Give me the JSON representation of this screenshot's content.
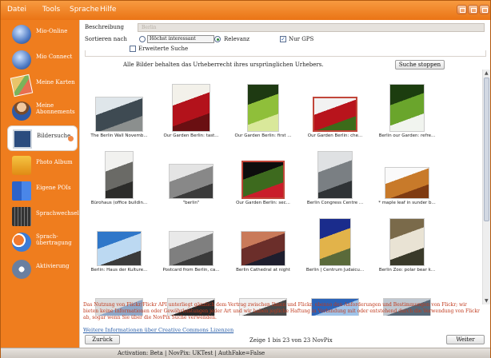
{
  "menu": [
    "Datei",
    "Tools",
    "Sprache",
    "Hilfe"
  ],
  "sidebar": {
    "items": [
      {
        "label": "Mio-Online",
        "icon": "globe-icon"
      },
      {
        "label": "Mio Connect",
        "icon": "monitor-globe-icon"
      },
      {
        "label": "Meine Karten",
        "icon": "map-icon"
      },
      {
        "label": "Meine Abonnements",
        "icon": "person-icon"
      },
      {
        "label": "Bildersuche",
        "icon": "monitor-icon"
      },
      {
        "label": "Photo Album",
        "icon": "photo-album-icon"
      },
      {
        "label": "Eigene POIs",
        "icon": "book-icon"
      },
      {
        "label": "Sprachwechsel",
        "icon": "keyboard-icon"
      },
      {
        "label": "Sprach-übertragung",
        "icon": "chat-icon"
      },
      {
        "label": "Aktivierung",
        "icon": "shield-icon"
      }
    ],
    "active": "Bildersuche"
  },
  "search": {
    "description_label": "Beschreibung",
    "description_value": "Berlin",
    "sort_label": "Sortieren nach",
    "sort_options": [
      "Höchst interessant",
      "Relevanz"
    ],
    "sort_selected": "Relevanz",
    "gps_label": "Nur GPS",
    "gps_checked": true,
    "advanced_label": "Erweiterte Suche",
    "advanced_checked": false,
    "copyright_note": "Alle Bilder behalten das Urheberrecht ihres ursprünglichen Urhebers.",
    "stop_button": "Suche stoppen"
  },
  "results": [
    {
      "caption": "The Berlin Wall Novemb...",
      "colors": [
        "#dfe6ea",
        "#3e4a52",
        "#8b8f8e"
      ]
    },
    {
      "caption": "Our Garden Berlin: tast...",
      "colors": [
        "#f3f1ea",
        "#b3121b",
        "#6a0f12"
      ]
    },
    {
      "caption": "Our Garden Berlin: first ...",
      "colors": [
        "#1e3a12",
        "#8fbf3a",
        "#d9e89a"
      ]
    },
    {
      "caption": "Our Garden Berlin: che...",
      "colors": [
        "#f2f2f2",
        "#b8141c",
        "#3c6b1a"
      ]
    },
    {
      "caption": "Berlin our Garden: refre...",
      "colors": [
        "#1c3d0f",
        "#6aa52c",
        "#f1f4ef"
      ]
    },
    {
      "caption": "Bürohaus (office buildin...",
      "colors": [
        "#f1f1ef",
        "#6a6a66",
        "#2c2c2a"
      ]
    },
    {
      "caption": "\"berlin\"",
      "colors": [
        "#e4e4e4",
        "#888888",
        "#3a3a3a"
      ]
    },
    {
      "caption": "Our Garden Berlin: sec...",
      "colors": [
        "#0d0d0d",
        "#3d6a1e",
        "#c91d2a"
      ]
    },
    {
      "caption": "Berlin Congress Centre ...",
      "colors": [
        "#dfe1e3",
        "#7a7f83",
        "#2f3336"
      ]
    },
    {
      "caption": "* maple leaf in sunder b...",
      "colors": [
        "#fafafa",
        "#c87a2a",
        "#7f3b12"
      ]
    },
    {
      "caption": "Berlin: Haus der Kulture...",
      "colors": [
        "#2f77c9",
        "#bcd9f2",
        "#3a3a3a"
      ]
    },
    {
      "caption": "Postcard from Berlin, ca...",
      "colors": [
        "#e9e9e9",
        "#7f7f7f",
        "#3a3a3a"
      ]
    },
    {
      "caption": "Berlin Cathedral at night",
      "colors": [
        "#c97a5a",
        "#6b2e2a",
        "#1e1e2e"
      ]
    },
    {
      "caption": "Berlin | Centrum Judaicu...",
      "colors": [
        "#1a2c8c",
        "#e2b34a",
        "#5a6a3a"
      ]
    },
    {
      "caption": "Berlin Zoo: polar bear k...",
      "colors": [
        "#7a6a4a",
        "#e9e3d4",
        "#3a3a2a"
      ]
    },
    {
      "caption": "",
      "colors": [
        "#dcdcdc",
        "#8fa8c8",
        "#444444"
      ]
    },
    {
      "caption": "",
      "colors": [
        "#e8e8e8",
        "#2a2a2a",
        "#9a6a3a"
      ]
    },
    {
      "caption": "",
      "colors": [
        "#f0f0f0",
        "#4a4a4a",
        "#1a1a1a"
      ]
    },
    {
      "caption": "",
      "colors": [
        "#2c64b8",
        "#9fc3e8",
        "#f0f0f0"
      ]
    },
    {
      "caption": "",
      "colors": [
        "#c0c8d0",
        "#566878",
        "#1a2028"
      ]
    }
  ],
  "selected_results": [
    3,
    7
  ],
  "notice": "Das Nutzung von Flickr/Flickr API unterliegt gänzlich dem Vertrag zwischen Ihnen und Flickr, ebenso den Anforderungen und Bestimmungen von Flickr; wir bieten keine Informationen oder Gewährleistungen jeder Art und wir haben jegliche Haftung in Verbindung mit oder entstehend durch die Verwendung von Flickr ab, sogar wenn Sie über die NovPix Suche verwenden.",
  "cc_link": "Weitere Informationen über Creative Commons Lizenzen",
  "pagination": {
    "back": "Zurück",
    "info": "Zeige 1 bis 23 von 23 NovPix",
    "next": "Weiter"
  },
  "status": "Activation: Beta | NovPix: UKTest | AuthFake=False",
  "colors": {
    "accent": "#ef7d1e",
    "notice": "#c0391c",
    "link": "#2a5ea8"
  }
}
